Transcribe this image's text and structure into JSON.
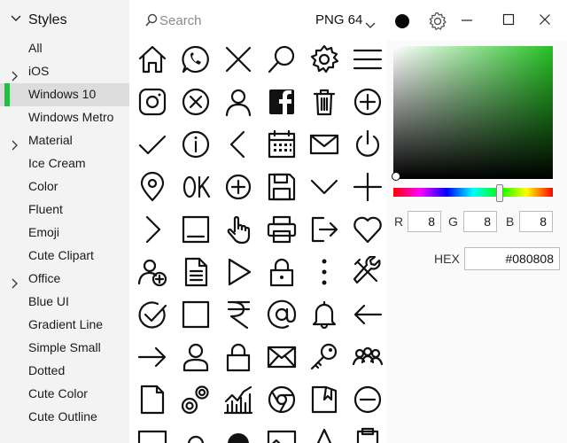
{
  "sidebar": {
    "header": "Styles",
    "items": [
      {
        "label": "All",
        "expandable": false
      },
      {
        "label": "iOS",
        "expandable": true
      },
      {
        "label": "Windows 10",
        "expandable": false,
        "selected": true
      },
      {
        "label": "Windows Metro",
        "expandable": false
      },
      {
        "label": "Material",
        "expandable": true
      },
      {
        "label": "Ice Cream",
        "expandable": false
      },
      {
        "label": "Color",
        "expandable": false
      },
      {
        "label": "Fluent",
        "expandable": false
      },
      {
        "label": "Emoji",
        "expandable": false
      },
      {
        "label": "Cute Clipart",
        "expandable": false
      },
      {
        "label": "Office",
        "expandable": true
      },
      {
        "label": "Blue UI",
        "expandable": false
      },
      {
        "label": "Gradient Line",
        "expandable": false
      },
      {
        "label": "Simple Small",
        "expandable": false
      },
      {
        "label": "Dotted",
        "expandable": false
      },
      {
        "label": "Cute Color",
        "expandable": false
      },
      {
        "label": "Cute Outline",
        "expandable": false
      }
    ]
  },
  "topbar": {
    "search_placeholder": "Search",
    "format": "PNG 64",
    "current_color": "#080808"
  },
  "icons": [
    [
      "home-icon",
      "whatsapp-icon",
      "close-x-icon",
      "search-icon",
      "gear-icon",
      "menu-icon"
    ],
    [
      "instagram-icon",
      "cancel-circle-icon",
      "user-icon",
      "facebook-icon",
      "trash-icon",
      "add-circle-icon"
    ],
    [
      "checkmark-icon",
      "info-icon",
      "chevron-left-icon",
      "calendar-icon",
      "mail-icon",
      "power-icon"
    ],
    [
      "location-pin-icon",
      "ok-icon",
      "plus-circle-icon",
      "save-icon",
      "chevron-down-icon",
      "plus-icon"
    ],
    [
      "chevron-right-icon",
      "minimize-window-icon",
      "hand-cursor-icon",
      "printer-icon",
      "logout-icon",
      "heart-icon"
    ],
    [
      "add-user-icon",
      "document-icon",
      "play-icon",
      "lock-icon",
      "more-vertical-icon",
      "tools-icon"
    ],
    [
      "check-circle-icon",
      "checkbox-unchecked-icon",
      "rupee-icon",
      "at-sign-icon",
      "bell-icon",
      "arrow-left-icon"
    ],
    [
      "arrow-right-icon",
      "person-icon",
      "padlock-icon",
      "envelope-icon",
      "key-icon",
      "group-icon"
    ],
    [
      "file-icon",
      "gears-icon",
      "chart-icon",
      "chrome-icon",
      "folder-icon",
      "remove-circle-icon"
    ],
    [
      "image-icon",
      "settings-icon",
      "globe-icon",
      "picture-icon",
      "tree-icon",
      "clipboard-icon"
    ]
  ],
  "color_panel": {
    "r_label": "R",
    "r": "8",
    "g_label": "G",
    "g": "8",
    "b_label": "B",
    "b": "8",
    "hex_label": "HEX",
    "hex": "#080808",
    "hue_color": "#25c225"
  }
}
